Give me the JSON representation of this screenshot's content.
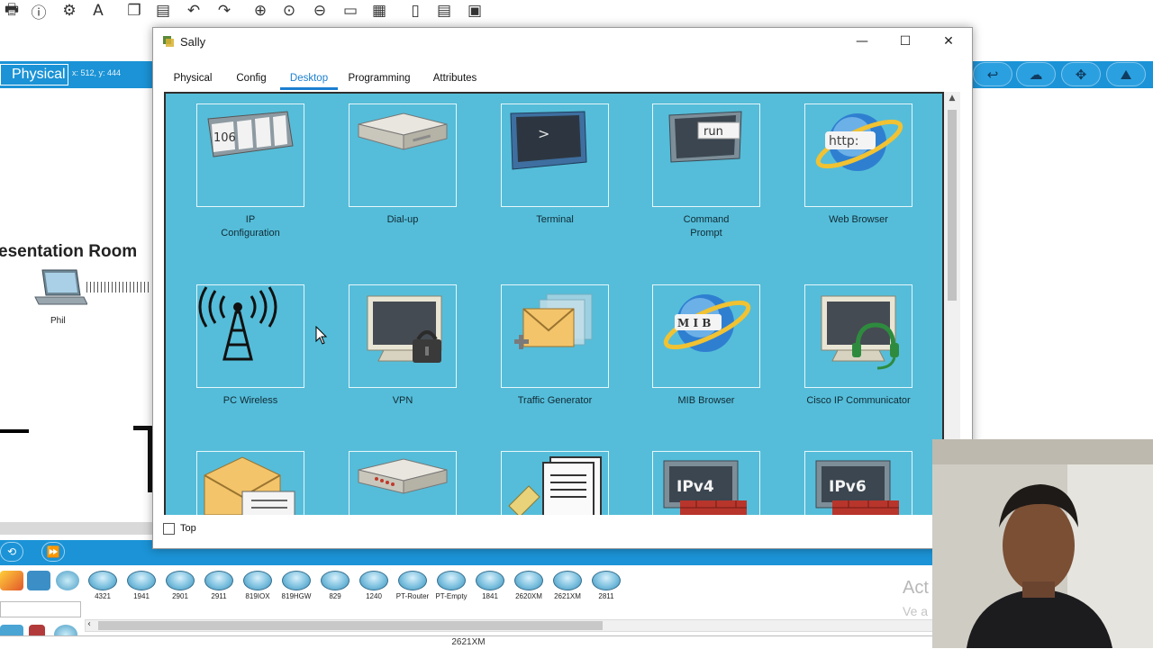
{
  "toolbar": {
    "icons": [
      "print-icon",
      "info-icon",
      "wizard-icon",
      "text-icon",
      "copy-icon",
      "paste-icon",
      "undo-icon",
      "redo-icon",
      "zoom-in-icon",
      "zoom-reset-icon",
      "zoom-out-icon",
      "rectangle-icon",
      "palette-icon",
      "notes-icon",
      "network-icon",
      "image-icon"
    ]
  },
  "workspace": {
    "mode_label": "Physical",
    "coords": "x: 512, y: 444",
    "room_label": "esentation Room",
    "device_label": "Phil"
  },
  "device_panel": {
    "devices": [
      "4321",
      "1941",
      "2901",
      "2911",
      "819IOX",
      "819HGW",
      "829",
      "1240",
      "PT-Router",
      "PT-Empty",
      "1841",
      "2620XM",
      "2621XM",
      "2811"
    ],
    "status_text": "2621XM",
    "watermark_line1": "Act",
    "watermark_line2": "Ve a"
  },
  "window": {
    "title": "Sally",
    "minimize": "—",
    "maximize": "☐",
    "close": "✕",
    "tabs": [
      {
        "label": "Physical"
      },
      {
        "label": "Config"
      },
      {
        "label": "Desktop"
      },
      {
        "label": "Programming"
      },
      {
        "label": "Attributes"
      }
    ],
    "active_tab": "Desktop",
    "apps": [
      {
        "label_line1": "IP",
        "label_line2": "Configuration",
        "icon": "ip-config-icon"
      },
      {
        "label_line1": "Dial-up",
        "label_line2": "",
        "icon": "dialup-modem-icon"
      },
      {
        "label_line1": "Terminal",
        "label_line2": "",
        "icon": "terminal-icon"
      },
      {
        "label_line1": "Command",
        "label_line2": "Prompt",
        "icon": "command-prompt-icon"
      },
      {
        "label_line1": "Web Browser",
        "label_line2": "",
        "icon": "web-browser-icon"
      },
      {
        "label_line1": "PC Wireless",
        "label_line2": "",
        "icon": "wireless-tower-icon"
      },
      {
        "label_line1": "VPN",
        "label_line2": "",
        "icon": "vpn-lock-icon"
      },
      {
        "label_line1": "Traffic Generator",
        "label_line2": "",
        "icon": "traffic-generator-icon"
      },
      {
        "label_line1": "MIB Browser",
        "label_line2": "",
        "icon": "mib-browser-icon"
      },
      {
        "label_line1": "Cisco IP Communicator",
        "label_line2": "",
        "icon": "ip-communicator-icon"
      },
      {
        "label_line1": "",
        "label_line2": "",
        "icon": "email-icon"
      },
      {
        "label_line1": "",
        "label_line2": "",
        "icon": "pppoe-dialer-icon"
      },
      {
        "label_line1": "",
        "label_line2": "",
        "icon": "text-editor-icon"
      },
      {
        "label_line1": "",
        "label_line2": "",
        "icon": "ipv4-firewall-icon"
      },
      {
        "label_line1": "",
        "label_line2": "",
        "icon": "ipv6-firewall-icon"
      }
    ],
    "icon_text": {
      "ip_config": "106",
      "terminal": ">",
      "command_prompt": "run",
      "web_browser": "http:",
      "mib_browser": "M I B",
      "ipv4": "IPv4",
      "ipv6": "IPv6"
    },
    "top_checkbox_label": "Top",
    "top_checked": false
  }
}
